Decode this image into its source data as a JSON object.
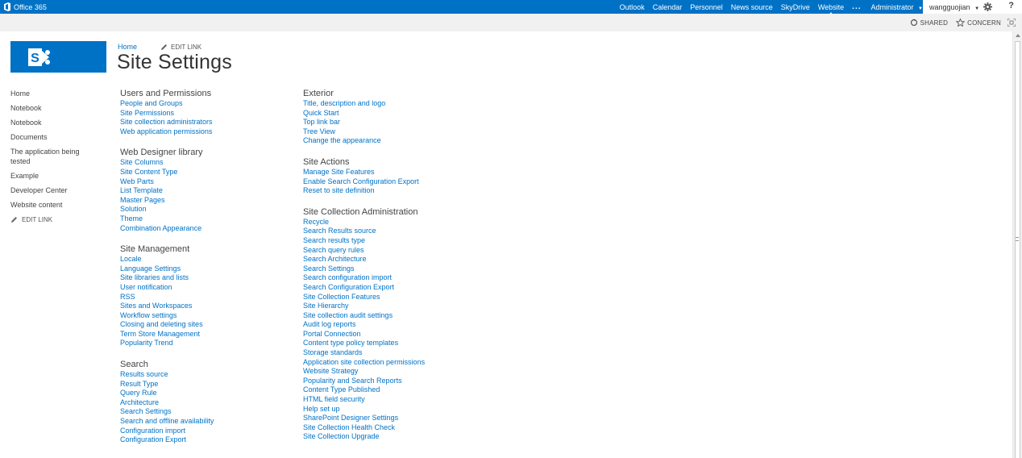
{
  "suitebar": {
    "brand": "Office 365",
    "nav": [
      {
        "label": "Outlook"
      },
      {
        "label": "Calendar"
      },
      {
        "label": "Personnel"
      },
      {
        "label": "News source"
      },
      {
        "label": "SkyDrive"
      },
      {
        "label": "Website"
      }
    ],
    "more": "...",
    "admin": "Administrator",
    "user": "wangguojian",
    "help": "?"
  },
  "ribbon": {
    "shared": "SHARED",
    "concern": "CONCERN"
  },
  "header": {
    "crumb_home": "Home",
    "edit_link": "EDIT LINK",
    "title": "Site Settings"
  },
  "quicklaunch": {
    "items": [
      {
        "label": "Home"
      },
      {
        "label": "Notebook"
      },
      {
        "label": "Notebook"
      },
      {
        "label": "Documents"
      },
      {
        "label": "The application being tested"
      },
      {
        "label": "Example"
      },
      {
        "label": "Developer Center"
      },
      {
        "label": "Website content"
      }
    ],
    "edit_link": "EDIT LINK"
  },
  "settings": {
    "col1": [
      {
        "heading": "Users and Permissions",
        "links": [
          "People and Groups",
          "Site Permissions",
          "Site collection administrators",
          "Web application permissions"
        ]
      },
      {
        "heading": "Web Designer library",
        "links": [
          "Site Columns",
          "Site Content Type",
          "Web Parts",
          "List Template",
          "Master Pages",
          "Solution",
          "Theme",
          "Combination Appearance"
        ]
      },
      {
        "heading": "Site Management",
        "links": [
          "Locale",
          "Language Settings",
          "Site libraries and lists",
          "User notification",
          "RSS",
          "Sites and Workspaces",
          "Workflow settings",
          "Closing and deleting sites",
          "Term Store Management",
          "Popularity Trend"
        ]
      },
      {
        "heading": "Search",
        "links": [
          "Results source",
          "Result Type",
          "Query Rule",
          "Architecture",
          "Search Settings",
          "Search and offline availability",
          "Configuration import",
          "Configuration Export"
        ]
      }
    ],
    "col2": [
      {
        "heading": "Exterior",
        "links": [
          "Title, description and logo",
          "Quick Start",
          "Top link bar",
          "Tree View",
          "Change the appearance"
        ]
      },
      {
        "heading": "Site Actions",
        "links": [
          "Manage Site Features",
          "Enable Search Configuration Export",
          "Reset to site definition"
        ]
      },
      {
        "heading": "Site Collection Administration",
        "links": [
          "Recycle",
          "Search Results source",
          "Search results type",
          "Search query rules",
          "Search Architecture",
          "Search Settings",
          "Search configuration import",
          "Search Configuration Export",
          "Site Collection Features",
          "Site Hierarchy",
          "Site collection audit settings",
          "Audit log reports",
          "Portal Connection",
          "Content type policy templates",
          "Storage standards",
          "Application site collection permissions",
          "Website Strategy",
          "Popularity and Search Reports",
          "Content Type Published",
          "HTML field security",
          "Help set up",
          "SharePoint Designer Settings",
          "Site Collection Health Check",
          "Site Collection Upgrade"
        ]
      }
    ]
  },
  "colors": {
    "suitebar": "#0072c6",
    "link": "#0072c6",
    "ribbon": "#f1f1f1"
  }
}
